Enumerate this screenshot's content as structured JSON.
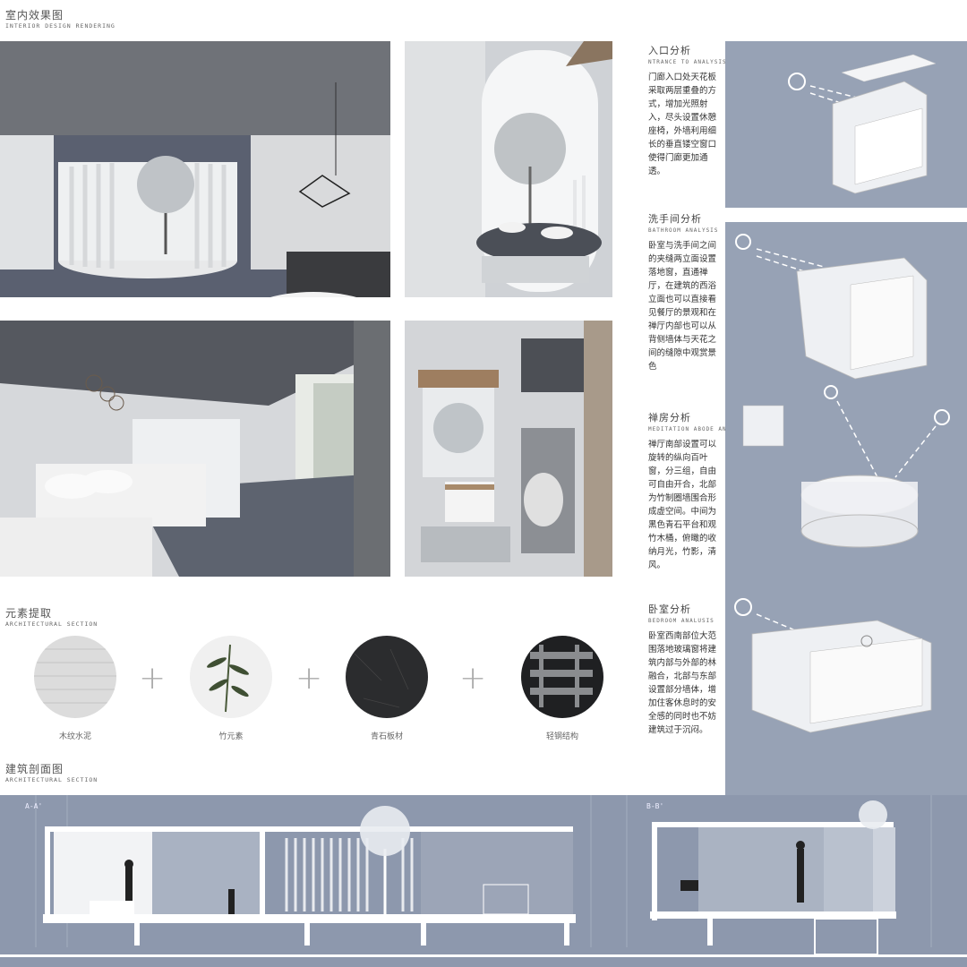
{
  "interior": {
    "title": "室内效果图",
    "subtitle": "INTERIOR DESIGN RENDERING"
  },
  "elements": {
    "title": "元素提取",
    "subtitle": "ARCHITECTURAL SECTION",
    "items": [
      {
        "label": "木纹水泥"
      },
      {
        "label": "竹元素"
      },
      {
        "label": "青石板材"
      },
      {
        "label": "轻钢结构"
      }
    ]
  },
  "section": {
    "title": "建筑剖面图",
    "subtitle": "ARCHITECTURAL SECTION",
    "label_a": "A-A'",
    "label_b": "B-B'"
  },
  "analysis": {
    "entrance": {
      "title": "入口分析",
      "subtitle": "NTRANCE TO ANALYSIS",
      "text": "门廊入口处天花板采取两层重叠的方式，增加光照射入，尽头设置休憩座椅，外墙利用细长的垂直镂空窗口使得门廊更加通透。"
    },
    "bathroom": {
      "title": "洗手间分析",
      "subtitle": "BATHROOM ANALYSIS",
      "text": "卧室与洗手间之间的夹缝两立面设置落地窗，直通禅厅，在建筑的西浴立面也可以直接看见餐厅的景观和在禅厅内部也可以从背侧墙体与天花之间的缝隙中观赏景色"
    },
    "meditation": {
      "title": "禅房分析",
      "subtitle": "MEDITATION ABODE ANALUSIS",
      "text": "禅厅南部设置可以旋转的纵向百叶窗，分三组，自由可自由开合，北部为竹制圈墙围合形成虚空间。中间为黑色青石平台和观竹木桶，俯瞰的收纳月光，竹影，清风。"
    },
    "bedroom": {
      "title": "卧室分析",
      "subtitle": "BEDROOM ANALUSIS",
      "text": "卧室西南部位大范围落地玻璃窗将建筑内部与外部的林融合，北部与东部设置部分墙体，增加住客休息时的安全感的同时也不妨建筑过于沉闷。"
    }
  },
  "colors": {
    "panel": "#97a2b5",
    "section_bg": "#8d98ad"
  }
}
